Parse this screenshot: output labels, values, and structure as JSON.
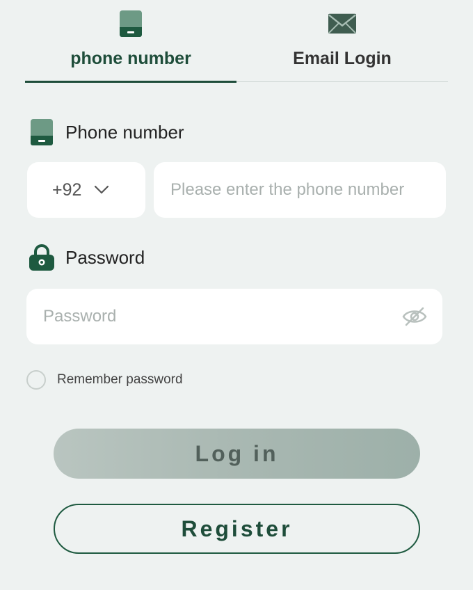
{
  "tabs": [
    {
      "label": "phone number",
      "icon": "phone-icon",
      "active": true
    },
    {
      "label": "Email Login",
      "icon": "mail-icon",
      "active": false
    }
  ],
  "phone_section": {
    "label": "Phone number",
    "icon": "phone-icon",
    "country_code": "+92",
    "placeholder": "Please enter the phone number",
    "value": ""
  },
  "password_section": {
    "label": "Password",
    "icon": "lock-icon",
    "placeholder": "Password",
    "value": ""
  },
  "remember": {
    "label": "Remember password",
    "checked": false
  },
  "buttons": {
    "login": "Log in",
    "register": "Register"
  },
  "colors": {
    "background": "#eef2f1",
    "accent": "#1e4d3a",
    "icon_light": "#6d9a85",
    "login_button": "#a9b8b2"
  }
}
